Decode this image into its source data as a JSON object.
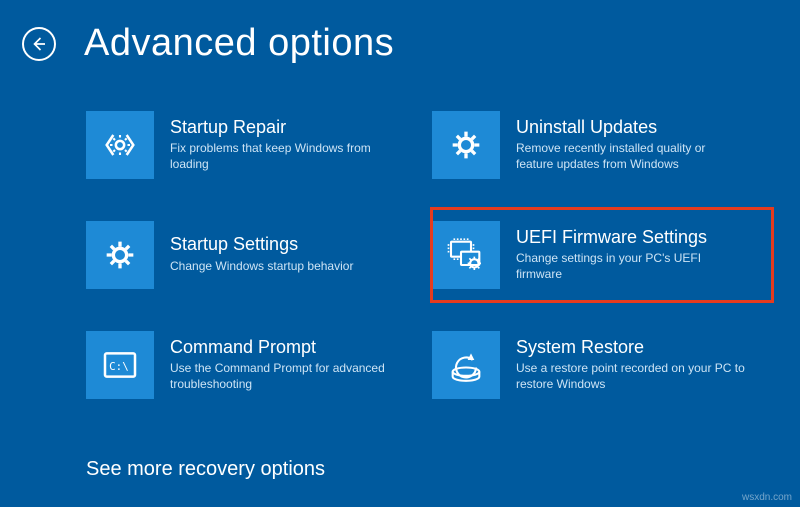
{
  "page_title": "Advanced options",
  "see_more": "See more recovery options",
  "watermark": "wsxdn.com",
  "options": [
    {
      "title": "Startup Repair",
      "desc": "Fix problems that keep Windows from loading"
    },
    {
      "title": "Uninstall Updates",
      "desc": "Remove recently installed quality or feature updates from Windows"
    },
    {
      "title": "Startup Settings",
      "desc": "Change Windows startup behavior"
    },
    {
      "title": "UEFI Firmware Settings",
      "desc": "Change settings in your PC's UEFI firmware"
    },
    {
      "title": "Command Prompt",
      "desc": "Use the Command Prompt for advanced troubleshooting"
    },
    {
      "title": "System Restore",
      "desc": "Use a restore point recorded on your PC to restore Windows"
    }
  ]
}
